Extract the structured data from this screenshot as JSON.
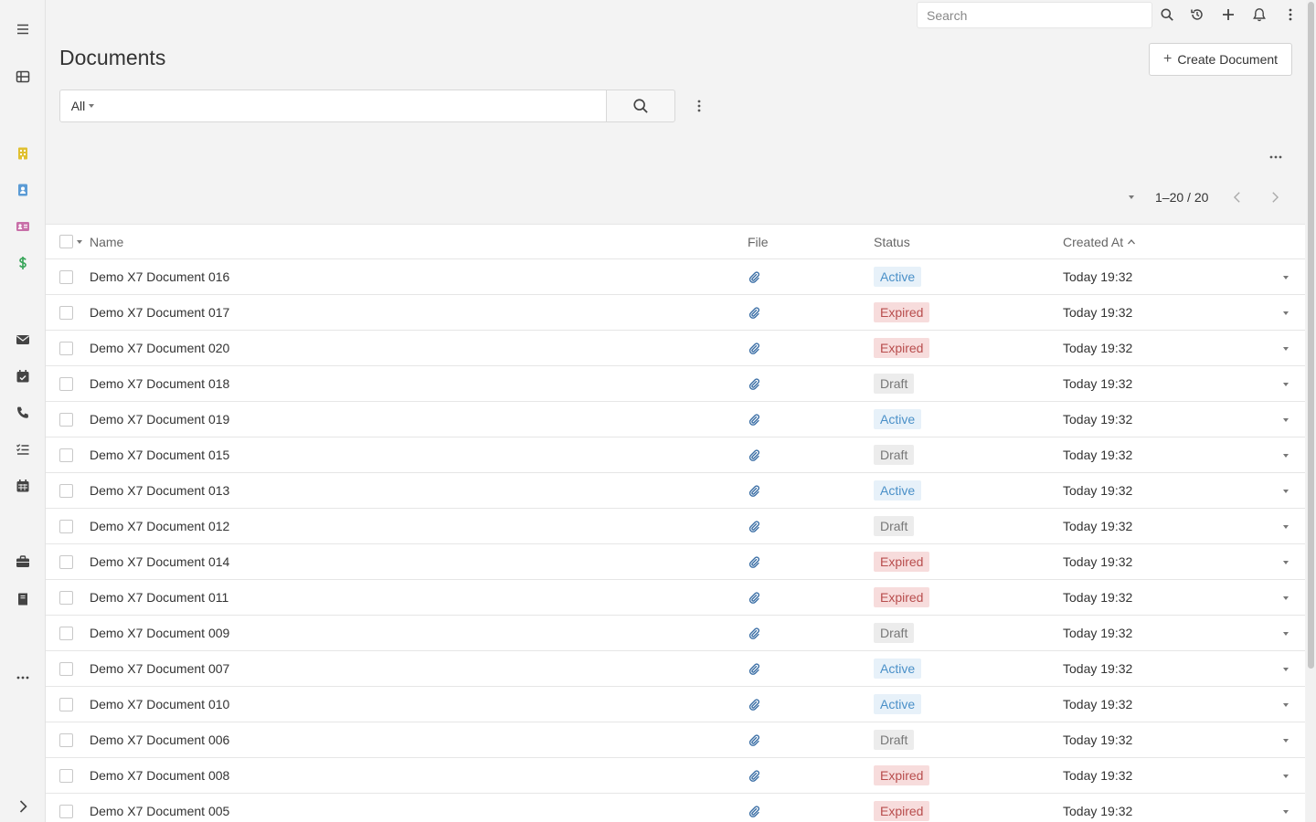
{
  "app": {
    "colors": {
      "accent": "#4a90c8",
      "expired": "#b84d4d",
      "draft": "#777777"
    }
  },
  "sidebar": {
    "items": [
      {
        "name": "menu-icon",
        "color": "#444444"
      },
      {
        "name": "grid-icon",
        "color": "#444444"
      },
      {
        "name": "building-icon",
        "color": "#e0c030"
      },
      {
        "name": "contact-icon",
        "color": "#5b9bd5"
      },
      {
        "name": "id-card-icon",
        "color": "#c86fa8"
      },
      {
        "name": "dollar-icon",
        "color": "#3aa65b"
      },
      {
        "name": "envelope-icon",
        "color": "#444444"
      },
      {
        "name": "calendar-check-icon",
        "color": "#444444"
      },
      {
        "name": "phone-icon",
        "color": "#444444"
      },
      {
        "name": "task-list-icon",
        "color": "#444444"
      },
      {
        "name": "calendar-icon",
        "color": "#444444"
      },
      {
        "name": "briefcase-icon",
        "color": "#444444"
      },
      {
        "name": "book-icon",
        "color": "#444444"
      },
      {
        "name": "more-icon",
        "color": "#444444"
      },
      {
        "name": "expand-icon",
        "color": "#444444"
      }
    ]
  },
  "topbar": {
    "search_placeholder": "Search"
  },
  "header": {
    "title": "Documents",
    "create_label": "Create Document"
  },
  "filter": {
    "scope_label": "All",
    "query": ""
  },
  "pagination": {
    "range": "1–20 / 20"
  },
  "table": {
    "columns": {
      "name": "Name",
      "file": "File",
      "status": "Status",
      "created": "Created At"
    },
    "rows": [
      {
        "name": "Demo X7 Document 016",
        "status": "Active",
        "status_type": "active",
        "created": "Today 19:32"
      },
      {
        "name": "Demo X7 Document 017",
        "status": "Expired",
        "status_type": "expired",
        "created": "Today 19:32"
      },
      {
        "name": "Demo X7 Document 020",
        "status": "Expired",
        "status_type": "expired",
        "created": "Today 19:32"
      },
      {
        "name": "Demo X7 Document 018",
        "status": "Draft",
        "status_type": "draft",
        "created": "Today 19:32"
      },
      {
        "name": "Demo X7 Document 019",
        "status": "Active",
        "status_type": "active",
        "created": "Today 19:32"
      },
      {
        "name": "Demo X7 Document 015",
        "status": "Draft",
        "status_type": "draft",
        "created": "Today 19:32"
      },
      {
        "name": "Demo X7 Document 013",
        "status": "Active",
        "status_type": "active",
        "created": "Today 19:32"
      },
      {
        "name": "Demo X7 Document 012",
        "status": "Draft",
        "status_type": "draft",
        "created": "Today 19:32"
      },
      {
        "name": "Demo X7 Document 014",
        "status": "Expired",
        "status_type": "expired",
        "created": "Today 19:32"
      },
      {
        "name": "Demo X7 Document 011",
        "status": "Expired",
        "status_type": "expired",
        "created": "Today 19:32"
      },
      {
        "name": "Demo X7 Document 009",
        "status": "Draft",
        "status_type": "draft",
        "created": "Today 19:32"
      },
      {
        "name": "Demo X7 Document 007",
        "status": "Active",
        "status_type": "active",
        "created": "Today 19:32"
      },
      {
        "name": "Demo X7 Document 010",
        "status": "Active",
        "status_type": "active",
        "created": "Today 19:32"
      },
      {
        "name": "Demo X7 Document 006",
        "status": "Draft",
        "status_type": "draft",
        "created": "Today 19:32"
      },
      {
        "name": "Demo X7 Document 008",
        "status": "Expired",
        "status_type": "expired",
        "created": "Today 19:32"
      },
      {
        "name": "Demo X7 Document 005",
        "status": "Expired",
        "status_type": "expired",
        "created": "Today 19:32"
      }
    ]
  }
}
